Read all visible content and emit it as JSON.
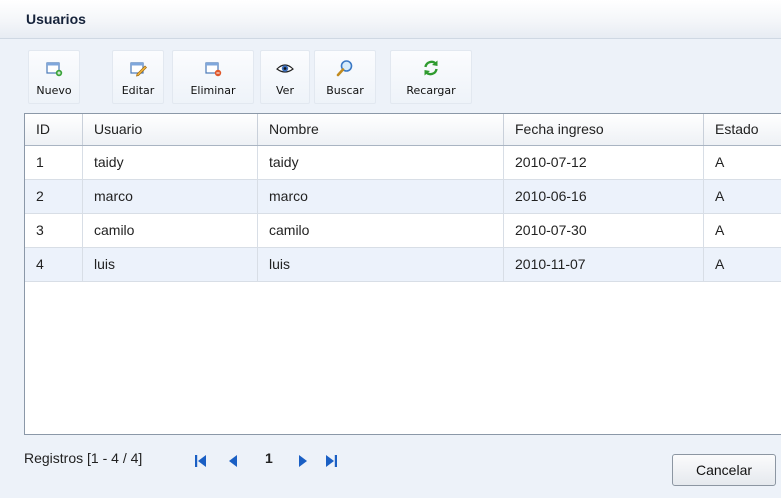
{
  "window": {
    "title": "Usuarios"
  },
  "toolbar": {
    "buttons": [
      {
        "label": "Nuevo",
        "icon": "new-window-icon"
      },
      {
        "label": "Editar",
        "icon": "edit-pencil-icon"
      },
      {
        "label": "Eliminar",
        "icon": "delete-window-icon"
      },
      {
        "label": "Ver",
        "icon": "eye-icon"
      },
      {
        "label": "Buscar",
        "icon": "magnifier-icon"
      },
      {
        "label": "Recargar",
        "icon": "refresh-icon"
      }
    ]
  },
  "grid": {
    "columns": [
      "ID",
      "Usuario",
      "Nombre",
      "Fecha ingreso",
      "Estado"
    ],
    "rows": [
      [
        "1",
        "taidy",
        "taidy",
        "2010-07-12",
        "A"
      ],
      [
        "2",
        "marco",
        "marco",
        "2010-06-16",
        "A"
      ],
      [
        "3",
        "camilo",
        "camilo",
        "2010-07-30",
        "A"
      ],
      [
        "4",
        "luis",
        "luis",
        "2010-11-07",
        "A"
      ]
    ]
  },
  "pager": {
    "range_text": "Registros [1 - 4 / 4]",
    "current_page": "1",
    "icons": [
      "first-page-icon",
      "previous-page-icon",
      "next-page-icon",
      "last-page-icon"
    ]
  },
  "footer": {
    "cancel_label": "Cancelar"
  },
  "colors": {
    "accent": "#1a5fc4",
    "row_alt": "#ecf2fb",
    "background": "#edf2f9"
  }
}
